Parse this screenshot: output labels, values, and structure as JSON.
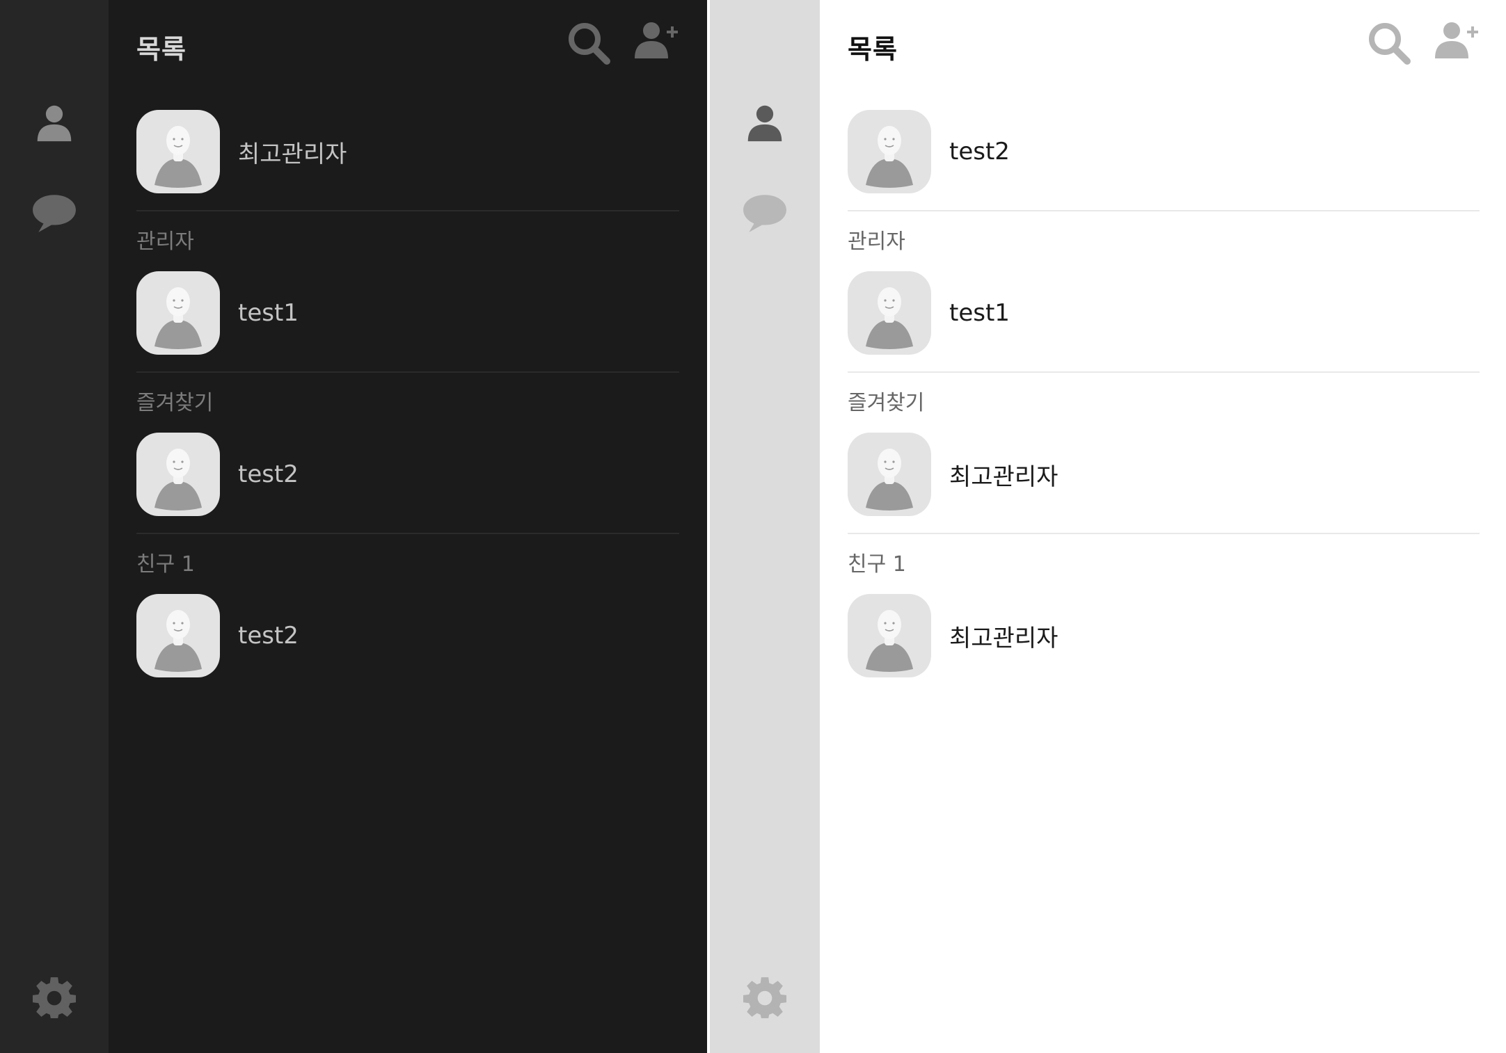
{
  "colors": {
    "dark_bg": "#1b1b1b",
    "dark_rail": "#262626",
    "light_bg": "#ffffff",
    "light_rail": "#dcdcdc",
    "avatar_bg": "#e3e3e3"
  },
  "dark": {
    "title": "목록",
    "nav": [
      "person-icon",
      "chat-bubble-icon",
      "gear-icon"
    ],
    "header_icons": [
      "search-icon",
      "add-friend-icon"
    ],
    "profile": {
      "name": "최고관리자"
    },
    "sections": [
      {
        "label": "관리자",
        "items": [
          {
            "name": "test1"
          }
        ]
      },
      {
        "label": "즐겨찾기",
        "items": [
          {
            "name": "test2"
          }
        ]
      },
      {
        "label": "친구 1",
        "items": [
          {
            "name": "test2"
          }
        ]
      }
    ]
  },
  "light": {
    "title": "목록",
    "nav": [
      "person-icon",
      "chat-bubble-icon",
      "gear-icon"
    ],
    "header_icons": [
      "search-icon",
      "add-friend-icon"
    ],
    "profile": {
      "name": "test2"
    },
    "sections": [
      {
        "label": "관리자",
        "items": [
          {
            "name": "test1"
          }
        ]
      },
      {
        "label": "즐겨찾기",
        "items": [
          {
            "name": "최고관리자"
          }
        ]
      },
      {
        "label": "친구 1",
        "items": [
          {
            "name": "최고관리자"
          }
        ]
      }
    ]
  }
}
